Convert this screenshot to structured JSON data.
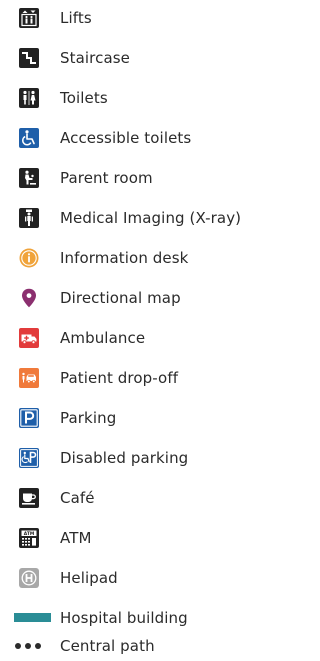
{
  "legend": {
    "items": [
      {
        "icon": "lift-icon",
        "label": "Lifts"
      },
      {
        "icon": "staircase-icon",
        "label": "Staircase"
      },
      {
        "icon": "toilets-icon",
        "label": "Toilets"
      },
      {
        "icon": "accessible-toilet-icon",
        "label": "Accessible toilets"
      },
      {
        "icon": "parent-room-icon",
        "label": "Parent room"
      },
      {
        "icon": "xray-icon",
        "label": "Medical Imaging (X-ray)"
      },
      {
        "icon": "info-icon",
        "label": "Information desk"
      },
      {
        "icon": "map-pin-icon",
        "label": "Directional map"
      },
      {
        "icon": "ambulance-icon",
        "label": "Ambulance"
      },
      {
        "icon": "drop-off-icon",
        "label": "Patient drop-off"
      },
      {
        "icon": "parking-icon",
        "label": "Parking"
      },
      {
        "icon": "disabled-parking-icon",
        "label": "Disabled parking"
      },
      {
        "icon": "cafe-icon",
        "label": "Café"
      },
      {
        "icon": "atm-icon",
        "label": "ATM"
      },
      {
        "icon": "helipad-icon",
        "label": "Helipad"
      },
      {
        "icon": "building-swatch-icon",
        "label": "Hospital building"
      },
      {
        "icon": "path-dots-icon",
        "label": "Central path"
      }
    ]
  },
  "colors": {
    "dark_icon": "#222222",
    "accessible_blue": "#1f5fa9",
    "info_orange": "#f0a33a",
    "pin_purple": "#8b2f6f",
    "ambulance_red": "#e23b3b",
    "dropoff_orange": "#f07a3b",
    "parking_blue": "#1f5fa9",
    "helipad_grey": "#a8a8a8",
    "building_teal": "#2a8d96",
    "text": "#2b2b2b"
  }
}
